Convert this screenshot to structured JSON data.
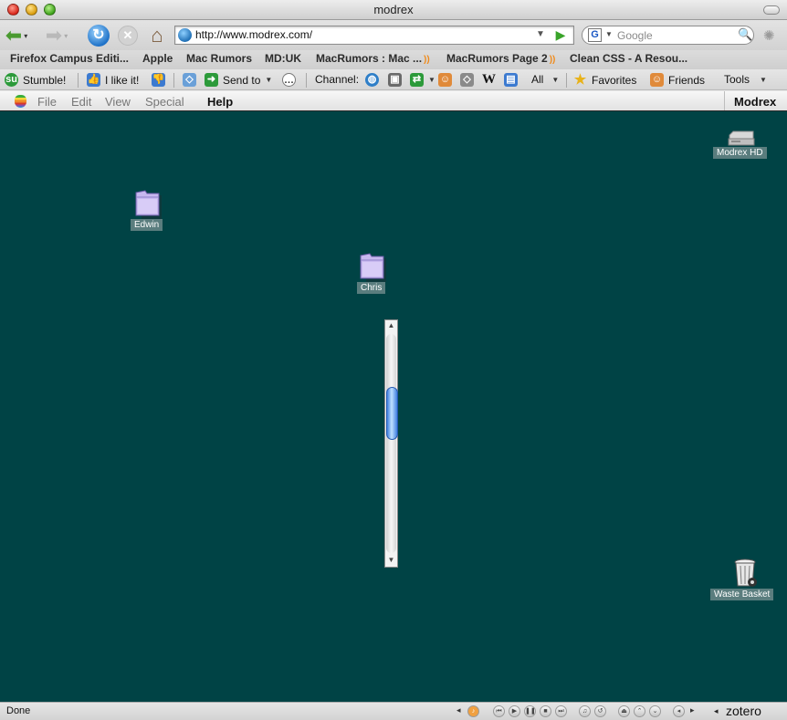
{
  "window": {
    "title": "modrex"
  },
  "navigation": {
    "url": "http://www.modrex.com/",
    "search_placeholder": "Google",
    "search_engine_glyph": "G"
  },
  "bookmarks": [
    {
      "label": "Firefox Campus Editi..."
    },
    {
      "label": "Apple"
    },
    {
      "label": "Mac Rumors"
    },
    {
      "label": "MD:UK"
    },
    {
      "label": "MacRumors : Mac ...",
      "rss": true
    },
    {
      "label": "MacRumors Page 2",
      "rss": true
    },
    {
      "label": "Clean CSS - A Resou..."
    }
  ],
  "stumbleupon": {
    "stumble_label": "Stumble!",
    "like_label": "I like it!",
    "send_label": "Send to",
    "channel_label": "Channel:",
    "all_label": "All",
    "favorites_label": "Favorites",
    "friends_label": "Friends",
    "tools_label": "Tools"
  },
  "menubar": {
    "items": [
      "File",
      "Edit",
      "View",
      "Special",
      "Help"
    ],
    "brand": "Modrex"
  },
  "desktop": {
    "background_color": "#004345",
    "icons": [
      {
        "name": "hard-drive",
        "label": "Modrex HD"
      },
      {
        "name": "folder",
        "label": "Edwin"
      },
      {
        "name": "folder",
        "label": "Chris"
      },
      {
        "name": "trash",
        "label": "Waste Basket"
      }
    ],
    "scrollbar_position": 0.32
  },
  "statusbar": {
    "status": "Done",
    "zotero_label": "zotero"
  }
}
